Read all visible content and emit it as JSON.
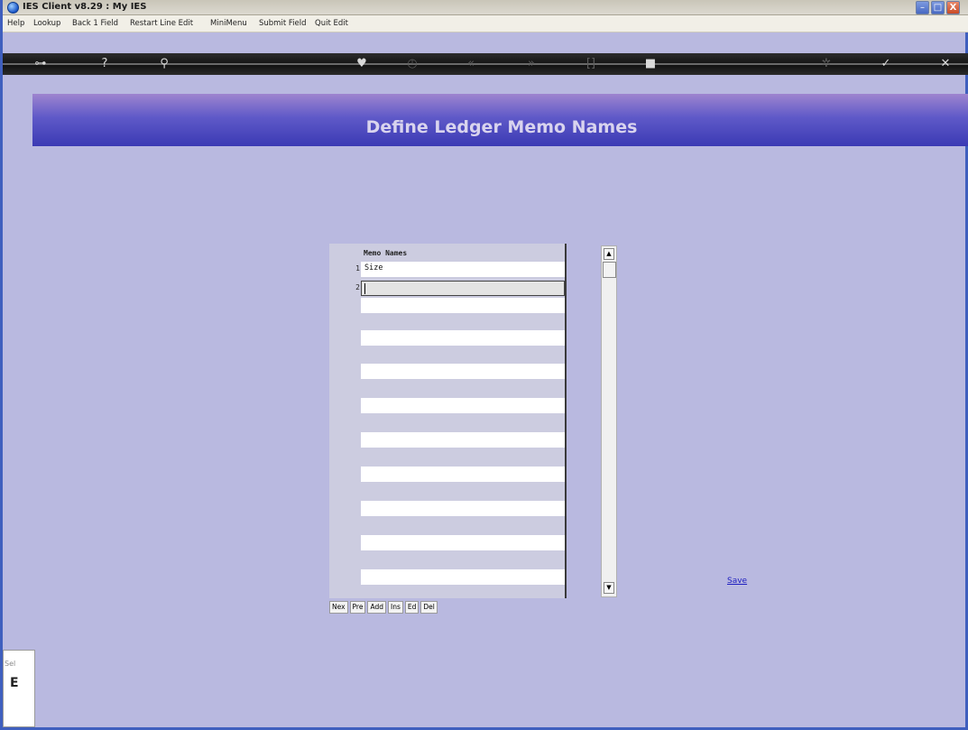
{
  "window": {
    "title": "IES Client v8.29 : My IES",
    "controls": {
      "minimize": "–",
      "maximize": "□",
      "close": "X"
    }
  },
  "menu": {
    "items": [
      "Help",
      "Lookup",
      "Back 1 Field",
      "Restart Line Edit",
      "MiniMenu",
      "Submit Field",
      "Quit Edit"
    ]
  },
  "toolbar": {
    "icons": [
      "key-icon",
      "help-icon",
      "search-icon",
      "heart-icon",
      "clock-icon",
      "back-icon",
      "forward-icon",
      "bracket-icon",
      "stop-icon",
      "settings-icon",
      "check-icon",
      "close-icon"
    ]
  },
  "banner": {
    "title": "Define Ledger Memo Names"
  },
  "grid": {
    "header": "Memo Names",
    "rows": [
      {
        "num": "1",
        "value": "Size"
      },
      {
        "num": "2",
        "value": ""
      }
    ]
  },
  "nav_buttons": [
    "Nex",
    "Pre",
    "Add",
    "Ins",
    "Ed",
    "Del"
  ],
  "save_link": "Save",
  "side_panel": {
    "label": "Sel",
    "value": "E"
  }
}
